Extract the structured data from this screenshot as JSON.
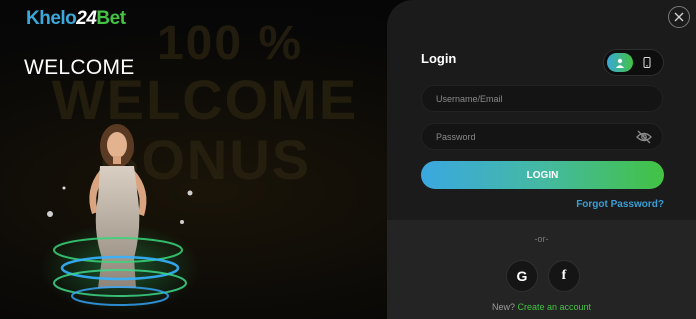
{
  "brand": {
    "logo_part1": "Khelo",
    "logo_part2": "24",
    "logo_part3": "Bet"
  },
  "left": {
    "welcome": "WELCOME",
    "bg_promo_line1": "100 %",
    "bg_promo_line2": "WELCOME BONUS"
  },
  "panel": {
    "title": "Login",
    "close_icon": "close-icon",
    "mode_toggle": {
      "options": [
        "user-icon",
        "phone-icon"
      ],
      "selected": "user-icon"
    },
    "username_placeholder": "Username/Email",
    "password_placeholder": "Password",
    "login_label": "LOGIN",
    "forgot_label": "Forgot Password?",
    "or_label": "-or-",
    "social": [
      "G",
      "f"
    ],
    "signup_prefix": "New?",
    "signup_link": "Create an account"
  },
  "colors": {
    "brand_blue": "#3aa8d8",
    "brand_green": "#43c244",
    "panel_bg": "#1b1b1b"
  }
}
